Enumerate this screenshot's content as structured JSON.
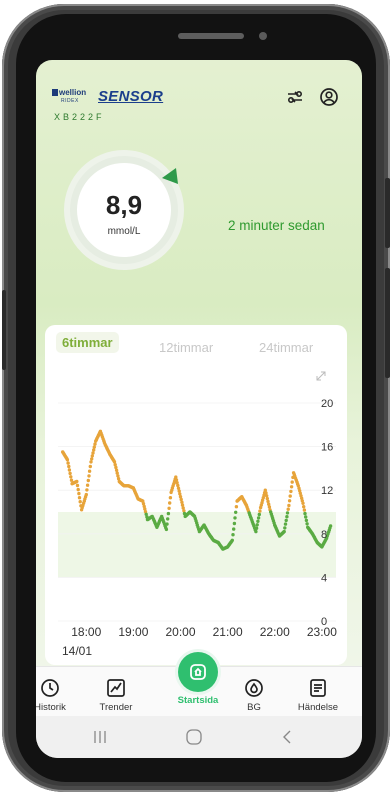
{
  "header": {
    "brand_logo": "wellion",
    "brand_logo_sub": "RIDEX",
    "brand_name": "SENSOR",
    "serial": "XB222F",
    "icons": [
      "switch-device-icon",
      "profile-icon"
    ]
  },
  "reading": {
    "value": "8,9",
    "unit": "mmol/L",
    "time_ago": "2 minuter sedan",
    "trend": "rising"
  },
  "chart": {
    "tabs": [
      "6timmar",
      "12timmar",
      "24timmar"
    ],
    "active_tab": "6timmar",
    "date": "14/01",
    "expand_icon": "expand-icon"
  },
  "chart_data": {
    "type": "scatter",
    "x_tick_labels": [
      "18:00",
      "19:00",
      "20:00",
      "21:00",
      "22:00",
      "23:00"
    ],
    "y_tick_labels": [
      "0",
      "4",
      "8",
      "12",
      "16",
      "20"
    ],
    "ylim": [
      0,
      20
    ],
    "target_range": [
      4,
      10
    ],
    "high_threshold": 10,
    "colors": {
      "above_range": "#e7a43a",
      "in_range": "#5aab43",
      "target_band": "#eef7e6"
    },
    "x": [
      17.5,
      17.6,
      17.7,
      17.8,
      17.9,
      18.0,
      18.1,
      18.2,
      18.3,
      18.4,
      18.5,
      18.6,
      18.7,
      18.8,
      18.9,
      19.0,
      19.1,
      19.2,
      19.3,
      19.4,
      19.5,
      19.6,
      19.7,
      19.8,
      19.9,
      20.0,
      20.1,
      20.2,
      20.3,
      20.4,
      20.5,
      20.6,
      20.7,
      20.8,
      20.9,
      21.0,
      21.1,
      21.2,
      21.3,
      21.4,
      21.5,
      21.6,
      21.7,
      21.8,
      21.9,
      22.0,
      22.1,
      22.2,
      22.3,
      22.4,
      22.5,
      22.6,
      22.7,
      22.8,
      22.9,
      23.0,
      23.1,
      23.2
    ],
    "y": [
      15.5,
      14.8,
      12.6,
      12.8,
      10.2,
      11.6,
      14.6,
      16.5,
      17.4,
      16.2,
      15.3,
      14.6,
      12.8,
      12.4,
      12.4,
      12.2,
      11.2,
      11.0,
      9.3,
      9.6,
      8.6,
      9.6,
      8.4,
      11.8,
      13.2,
      11.4,
      9.6,
      10.0,
      9.6,
      8.2,
      8.8,
      8.0,
      7.4,
      7.2,
      6.6,
      6.8,
      7.4,
      11.0,
      11.4,
      10.6,
      9.4,
      8.2,
      10.4,
      12.0,
      10.2,
      8.8,
      7.8,
      8.2,
      10.6,
      13.6,
      12.4,
      10.8,
      8.6,
      8.0,
      7.2,
      6.8,
      7.6,
      8.9
    ]
  },
  "nav": {
    "items": [
      {
        "label": "Historik",
        "icon": "history-icon"
      },
      {
        "label": "Trender",
        "icon": "trend-icon"
      },
      {
        "label": "Startsida",
        "icon": "home-icon"
      },
      {
        "label": "BG",
        "icon": "drop-icon"
      },
      {
        "label": "Händelse",
        "icon": "event-icon"
      }
    ],
    "active": "Startsida"
  },
  "system_nav": [
    "recents-icon",
    "home-circle-icon",
    "back-icon"
  ]
}
